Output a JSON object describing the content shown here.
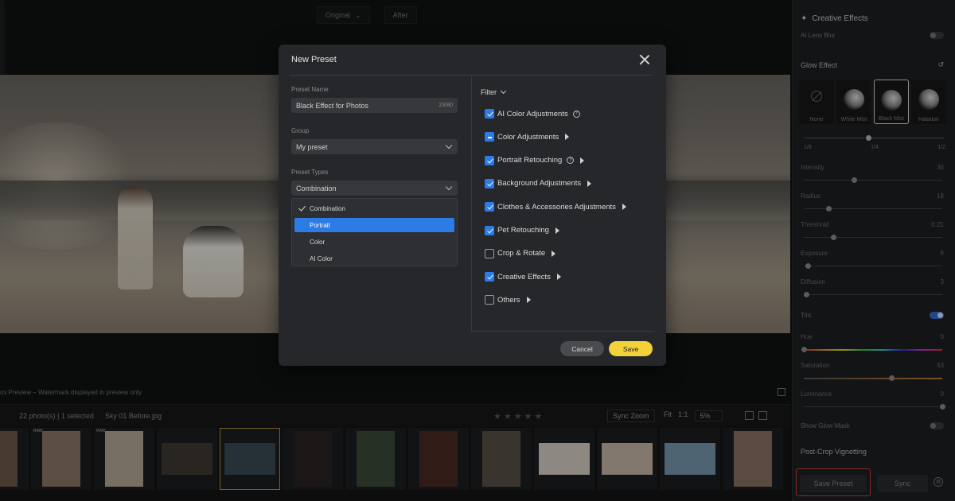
{
  "viewer": {
    "original_label": "Original",
    "after_label": "After",
    "preview_note": "ox Preview – Watermark displayed in preview only."
  },
  "filmstrip": {
    "photo_count": "22 photo(s) | 1 selected",
    "selected_name": "Sky 01 Before.jpg",
    "sync_zoom": "Sync Zoom",
    "fit": "Fit",
    "ratio": "1:1",
    "zoom_pct": "5%",
    "raw_tag": "RAW",
    "thumbnail_count": 13
  },
  "right_panel": {
    "creative_effects_title": "Creative Effects",
    "ai_lens_blur": "AI Lens Blur",
    "glow_effect_title": "Glow Effect",
    "effects": [
      "None",
      "White Mist",
      "Black Mist",
      "Halation"
    ],
    "selected_effect": "Black Mist",
    "steps": [
      "1/8",
      "1/4",
      "1/2"
    ],
    "sliders": [
      {
        "label": "Intensity",
        "value": "36",
        "position": 0.36
      },
      {
        "label": "Radius",
        "value": "18",
        "position": 0.18
      },
      {
        "label": "Threshold",
        "value": "0.21",
        "position": 0.21
      },
      {
        "label": "Exposure",
        "value": "6",
        "position": 0.03
      },
      {
        "label": "Diffusion",
        "value": "3",
        "position": 0.02
      }
    ],
    "tint_label": "Tint",
    "tint_sliders": [
      {
        "label": "Hue",
        "value": "0",
        "position": 0.0
      },
      {
        "label": "Saturation",
        "value": "63",
        "position": 0.63
      },
      {
        "label": "Luminance",
        "value": "0",
        "position": 1.0
      }
    ],
    "show_glow_mask": "Show Glow Mask",
    "post_crop": "Post-Crop Vignetting",
    "save_preset": "Save Preset",
    "sync": "Sync"
  },
  "modal": {
    "title": "New Preset",
    "preset_name_label": "Preset Name",
    "preset_name_value": "Black Effect for Photos",
    "preset_name_counter": "23/80",
    "group_label": "Group",
    "group_value": "My preset",
    "types_label": "Preset Types",
    "types_value": "Combination",
    "type_options": [
      "Combination",
      "Portrait",
      "Color",
      "AI Color"
    ],
    "type_checked": "Combination",
    "type_highlighted": "Portrait",
    "filter_label": "Filter",
    "filters": [
      {
        "label": "AI Color Adjustments",
        "state": "checked",
        "help": true,
        "arrow": false
      },
      {
        "label": "Color Adjustments",
        "state": "partial",
        "help": false,
        "arrow": true
      },
      {
        "label": "Portrait Retouching",
        "state": "checked",
        "help": true,
        "arrow": true
      },
      {
        "label": "Background Adjustments",
        "state": "checked",
        "help": false,
        "arrow": true
      },
      {
        "label": "Clothes & Accessories Adjustments",
        "state": "checked",
        "help": false,
        "arrow": true
      },
      {
        "label": "Pet Retouching",
        "state": "checked",
        "help": false,
        "arrow": true
      },
      {
        "label": "Crop & Rotate",
        "state": "unchecked",
        "help": false,
        "arrow": true
      },
      {
        "label": "Creative Effects",
        "state": "checked",
        "help": false,
        "arrow": true
      },
      {
        "label": "Others",
        "state": "unchecked",
        "help": false,
        "arrow": true
      }
    ],
    "cancel": "Cancel",
    "save": "Save"
  }
}
